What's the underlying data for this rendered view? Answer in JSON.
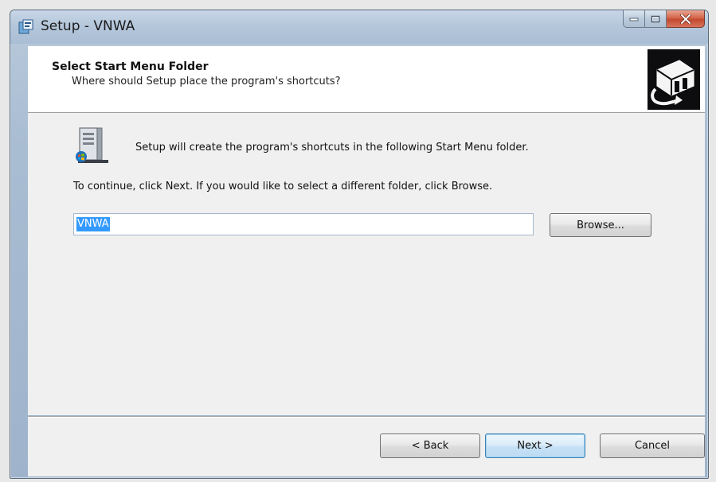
{
  "window": {
    "title": "Setup - VNWA",
    "caption_buttons": {
      "minimize_icon": "minimize-icon",
      "maximize_icon": "maximize-icon",
      "close_icon": "close-icon"
    }
  },
  "header": {
    "title": "Select Start Menu Folder",
    "subtitle": "Where should Setup place the program's shortcuts?"
  },
  "body": {
    "info_text": "Setup will create the program's shortcuts in the following Start Menu folder.",
    "continue_text": "To continue, click Next. If you would like to select a different folder, click Browse.",
    "folder_value": "VNWA",
    "browse_label": "Browse..."
  },
  "footer": {
    "back_label": "< Back",
    "next_label": "Next >",
    "cancel_label": "Cancel"
  },
  "colors": {
    "selection": "#3399ff",
    "close_button": "#c9543a",
    "default_button_border": "#3c7fb1"
  }
}
